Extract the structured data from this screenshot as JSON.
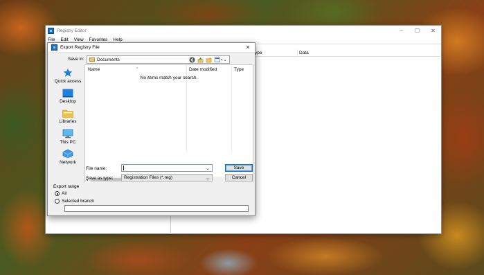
{
  "registry_editor": {
    "title": "Registry Editor",
    "menu": [
      "File",
      "Edit",
      "View",
      "Favorites",
      "Help"
    ],
    "columns": {
      "type": "ype",
      "data": "Data"
    },
    "controls": {
      "minimize": "–",
      "maximize": "☐",
      "close": "✕"
    }
  },
  "dialog": {
    "title": "Export Registry File",
    "close": "✕",
    "save_in": {
      "label": "Save in:",
      "value": "Documents"
    },
    "toolbar_icons": [
      "back-icon",
      "up-folder-icon",
      "new-folder-icon",
      "view-menu-icon"
    ],
    "places": [
      {
        "label": "Quick access",
        "icon": "star-icon"
      },
      {
        "label": "Desktop",
        "icon": "desktop-icon"
      },
      {
        "label": "Libraries",
        "icon": "libraries-icon"
      },
      {
        "label": "This PC",
        "icon": "computer-icon"
      },
      {
        "label": "Network",
        "icon": "network-icon"
      }
    ],
    "file_list": {
      "columns": [
        "Name",
        "Date modified",
        "Type"
      ],
      "empty_message": "No items match your search."
    },
    "file_name": {
      "label": "File name:",
      "value": ""
    },
    "save_as_type": {
      "label": "Save as type:",
      "value": "Registration Files (*.reg)"
    },
    "buttons": {
      "save": "Save",
      "cancel": "Cancel"
    },
    "export_range": {
      "label": "Export range",
      "options": [
        {
          "label": "All",
          "selected": true
        },
        {
          "label": "Selected branch",
          "selected": false
        }
      ],
      "branch_value": ""
    }
  }
}
